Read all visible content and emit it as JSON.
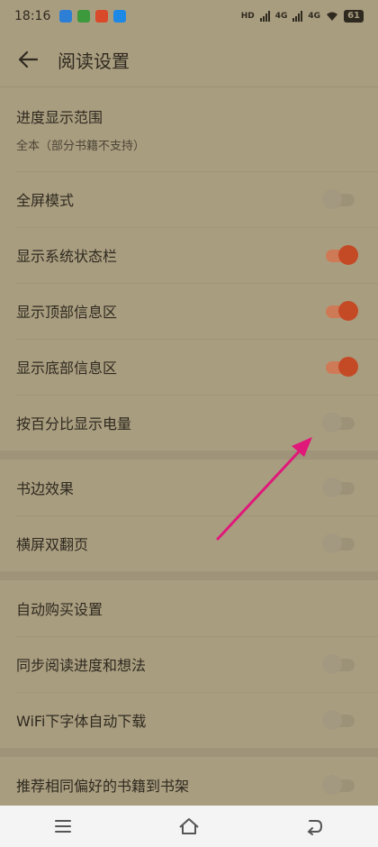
{
  "status_bar": {
    "time": "18:16",
    "network_1": "4G",
    "network_2": "4G",
    "battery": "61"
  },
  "header": {
    "title": "阅读设置"
  },
  "sections": [
    {
      "items": [
        {
          "label": "进度显示范围",
          "subtitle": "全本（部分书籍不支持）"
        },
        {
          "label": "全屏模式",
          "toggle": false
        },
        {
          "label": "显示系统状态栏",
          "toggle": true
        },
        {
          "label": "显示顶部信息区",
          "toggle": true
        },
        {
          "label": "显示底部信息区",
          "toggle": true
        },
        {
          "label": "按百分比显示电量",
          "toggle": false
        }
      ]
    },
    {
      "items": [
        {
          "label": "书边效果",
          "toggle": false
        },
        {
          "label": "横屏双翻页",
          "toggle": false
        }
      ]
    },
    {
      "items": [
        {
          "label": "自动购买设置"
        },
        {
          "label": "同步阅读进度和想法",
          "toggle": false
        },
        {
          "label": "WiFi下字体自动下载",
          "toggle": false
        }
      ]
    },
    {
      "items": [
        {
          "label": "推荐相同偏好的书籍到书架",
          "toggle": false
        }
      ]
    }
  ],
  "colors": {
    "background": "#a99d80",
    "toggle_on": "#c44a26",
    "annotation_arrow": "#e0187a"
  }
}
